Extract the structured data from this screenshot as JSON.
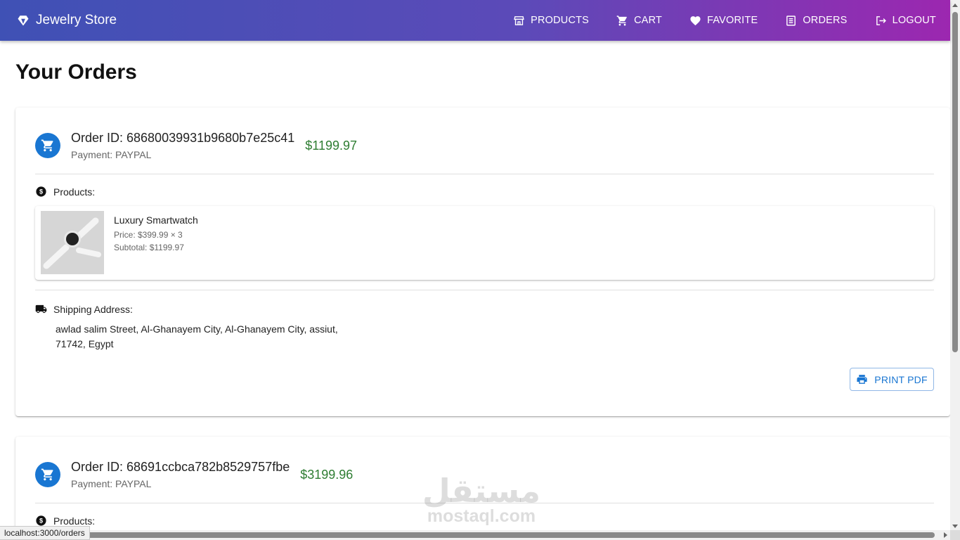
{
  "appbar": {
    "brand": "Jewelry Store",
    "nav": [
      {
        "label": "PRODUCTS",
        "icon": "store-icon"
      },
      {
        "label": "CART",
        "icon": "cart-icon"
      },
      {
        "label": "FAVORITE",
        "icon": "heart-icon"
      },
      {
        "label": "ORDERS",
        "icon": "list-icon"
      },
      {
        "label": "LOGOUT",
        "icon": "logout-icon"
      }
    ]
  },
  "page": {
    "title": "Your Orders"
  },
  "orders": [
    {
      "id_label": "Order ID: 68680039931b9680b7e25c41",
      "payment": "Payment: PAYPAL",
      "total": "$1199.97",
      "products_label": "Products:",
      "products": [
        {
          "name": "Luxury Smartwatch",
          "price": "Price: $399.99 × 3",
          "subtotal": "Subtotal: $1199.97"
        }
      ],
      "shipping_label": "Shipping Address:",
      "address": "awlad salim Street, Al-Ghanayem City, Al-Ghanayem City, assiut, 71742, Egypt",
      "print_label": "PRINT PDF"
    },
    {
      "id_label": "Order ID: 68691ccbca782b8529757fbe",
      "payment": "Payment: PAYPAL",
      "total": "$3199.96",
      "products_label": "Products:"
    }
  ],
  "watermark": {
    "arabic": "مستقل",
    "latin": "mostaql.com"
  },
  "statusbar": {
    "url": "localhost:3000/orders"
  },
  "colors": {
    "appbar_start": "#3f51b5",
    "appbar_end": "#9c27b0",
    "accent": "#1976d2",
    "total": "#2e7d32"
  }
}
